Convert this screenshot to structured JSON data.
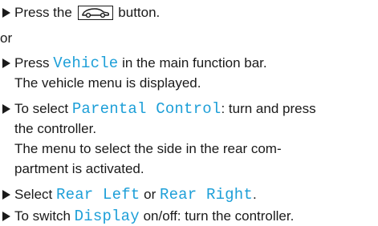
{
  "steps": [
    {
      "id": "press-button",
      "before": "Press the",
      "after": "button.",
      "icon": "car-icon"
    },
    {
      "id": "or",
      "text": "or"
    },
    {
      "id": "press-vehicle",
      "before": "Press ",
      "keyword": "Vehicle",
      "after": " in the main function bar.",
      "line2": "The vehicle menu is displayed."
    },
    {
      "id": "select-parental",
      "before": "To select ",
      "keyword": "Parental Control",
      "after": ": turn and press",
      "line2": "the controller.",
      "line3": "The menu to select the side in the rear com-",
      "line4": "partment is activated."
    },
    {
      "id": "select-side",
      "before": "Select ",
      "keyword1": "Rear Left",
      "middle": " or ",
      "keyword2": "Rear Right",
      "after": "."
    },
    {
      "id": "switch-display",
      "before": "To switch ",
      "keyword": "Display",
      "after": " on/off: turn the controller."
    }
  ],
  "colors": {
    "keyword": "#1d9fd8",
    "text": "#1a1a1a"
  }
}
